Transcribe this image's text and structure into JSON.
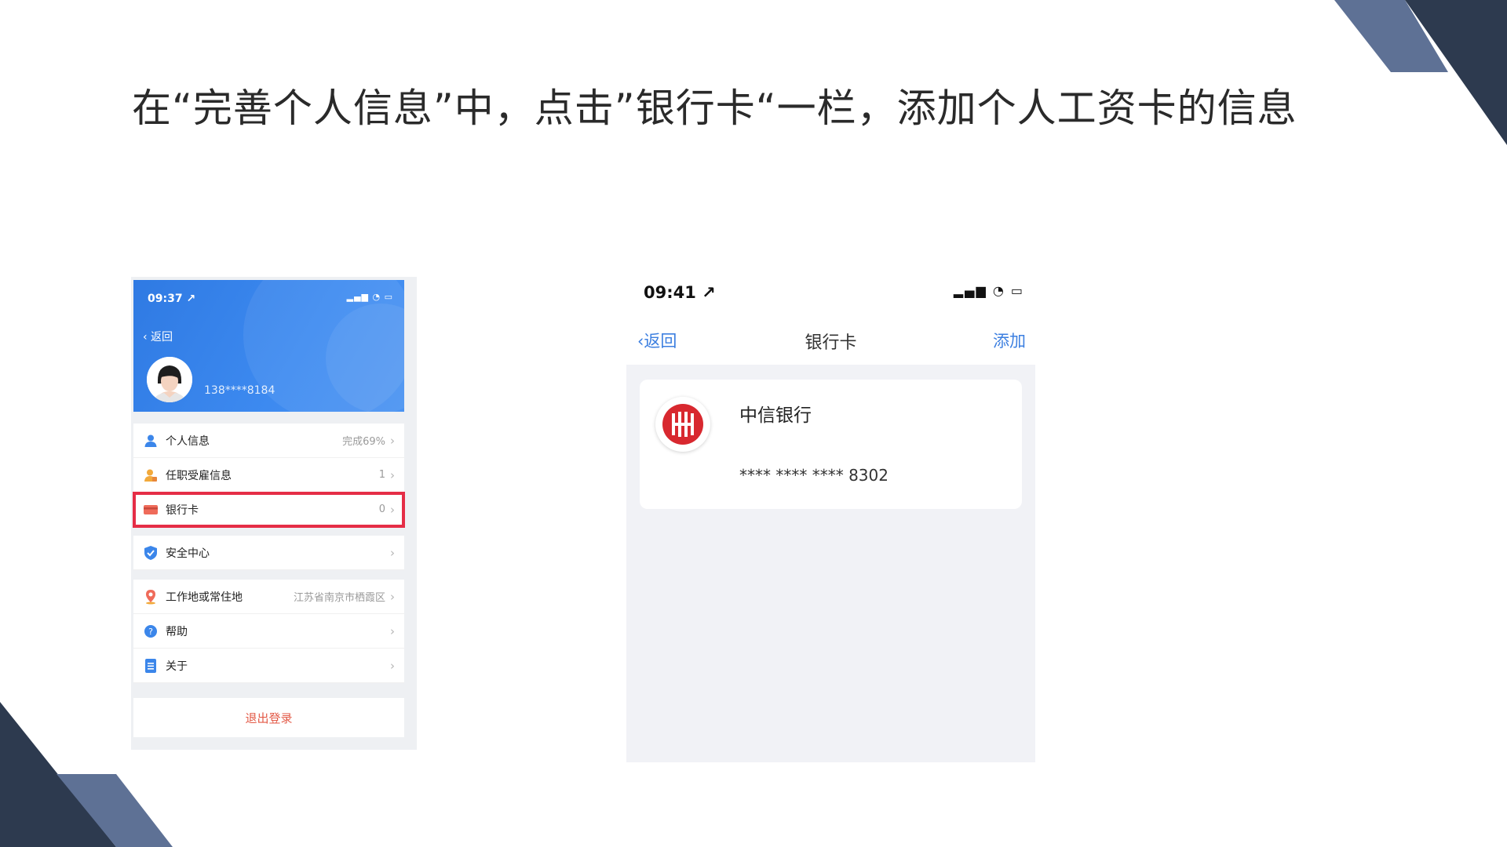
{
  "slide": {
    "title": "在“完善个人信息”中，点击”银行卡“一栏，添加个人工资卡的信息"
  },
  "colors": {
    "deco_dark": "#2d3a4f",
    "deco_light": "#5e7195",
    "profile_blue": "#2f7ae3",
    "highlight_red": "#e52d46",
    "link_blue": "#3c7fe0",
    "logout_red": "#e35a47"
  },
  "phone1": {
    "status": {
      "time": "09:37 ↗",
      "icons": "▂▄▆ ◔ ▭"
    },
    "back_label": "‹ 返回",
    "avatar_icon": "user-avatar",
    "phone_masked": "138****8184",
    "groups": [
      [
        {
          "icon": "person-icon",
          "label": "个人信息",
          "value": "完成69%",
          "chevron": "›"
        },
        {
          "icon": "employment-icon",
          "label": "任职受雇信息",
          "value": "1",
          "chevron": "›"
        },
        {
          "icon": "bank-card-icon",
          "label": "银行卡",
          "value": "0",
          "chevron": "›",
          "highlighted": true
        }
      ],
      [
        {
          "icon": "shield-icon",
          "label": "安全中心",
          "value": "",
          "chevron": "›"
        }
      ],
      [
        {
          "icon": "location-pin-icon",
          "label": "工作地或常住地",
          "value": "江苏省南京市栖霞区",
          "chevron": "›"
        },
        {
          "icon": "help-icon",
          "label": "帮助",
          "value": "",
          "chevron": "›"
        },
        {
          "icon": "about-icon",
          "label": "关于",
          "value": "",
          "chevron": "›"
        }
      ]
    ],
    "logout_label": "退出登录"
  },
  "phone2": {
    "status": {
      "time": "09:41 ↗",
      "icons": "▂▄▆ ◔ ▭"
    },
    "nav": {
      "back_label": "‹返回",
      "title": "银行卡",
      "add_label": "添加"
    },
    "card": {
      "bank_logo_icon": "citic-bank-logo",
      "bank_name": "中信银行",
      "card_number": "**** **** **** 8302"
    }
  }
}
